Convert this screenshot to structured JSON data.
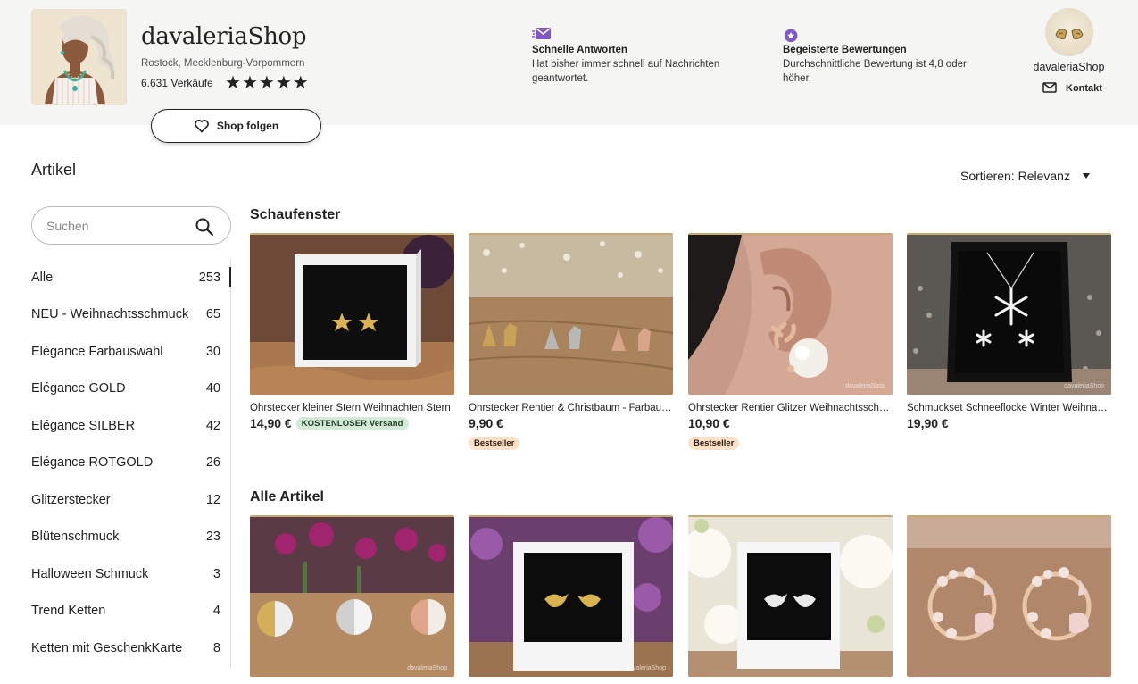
{
  "shop": {
    "name": "davaleriaShop",
    "location": "Rostock, Mecklenburg-Vorpommern",
    "sales": "6.631 Verkäufe",
    "rating": 5,
    "follow_label": "Shop folgen"
  },
  "features": [
    {
      "title": "Schnelle Antworten",
      "desc": "Hat bisher immer schnell auf Nachrichten geantwortet.",
      "icon": "envelope-fast-icon",
      "color": "#7f58c4"
    },
    {
      "title": "Begeisterte Bewertungen",
      "desc": "Durchschnittliche Bewertung ist 4,8 oder höher.",
      "icon": "star-badge-icon",
      "color": "#7f58c4"
    }
  ],
  "owner": {
    "name": "davaleriaShop",
    "contact_label": "Kontakt"
  },
  "sidebar": {
    "title": "Artikel",
    "search_placeholder": "Suchen",
    "categories": [
      {
        "label": "Alle",
        "count": "253",
        "active": true
      },
      {
        "label": "NEU - Weihnachtsschmuck",
        "count": "65"
      },
      {
        "label": "Elégance Farbauswahl",
        "count": "30"
      },
      {
        "label": "Elégance GOLD",
        "count": "40"
      },
      {
        "label": "Elégance SILBER",
        "count": "42"
      },
      {
        "label": "Elégance ROTGOLD",
        "count": "26"
      },
      {
        "label": "Glitzerstecker",
        "count": "12"
      },
      {
        "label": "Blütenschmuck",
        "count": "23"
      },
      {
        "label": "Halloween Schmuck",
        "count": "3"
      },
      {
        "label": "Trend Ketten",
        "count": "4"
      },
      {
        "label": "Ketten mit GeschenkKarte",
        "count": "8"
      }
    ]
  },
  "sort": {
    "label": "Sortieren: Relevanz"
  },
  "showcase": {
    "title": "Schaufenster",
    "items": [
      {
        "title": "Ohrstecker kleiner Stern Weihnachten Stern",
        "price": "14,90 €",
        "badge_free": "KOSTENLOSER Versand"
      },
      {
        "title": "Ohrstecker Rentier & Christbaum - Farbauswahl",
        "price": "9,90 €",
        "badge_best": "Bestseller"
      },
      {
        "title": "Ohrstecker Rentier Glitzer Weihnachtsschmuck",
        "price": "10,90 €",
        "badge_best": "Bestseller"
      },
      {
        "title": "Schmuckset Schneeflocke Winter Weihnachten",
        "price": "19,90 €"
      }
    ]
  },
  "all_items": {
    "title": "Alle Artikel"
  },
  "watermark": "davaleriaShop",
  "colors": {
    "accent_purple": "#7f58c4",
    "badge_green": "#d4e9d7",
    "badge_peach": "#fbe1c7",
    "header_bg": "#f5f5f4"
  }
}
